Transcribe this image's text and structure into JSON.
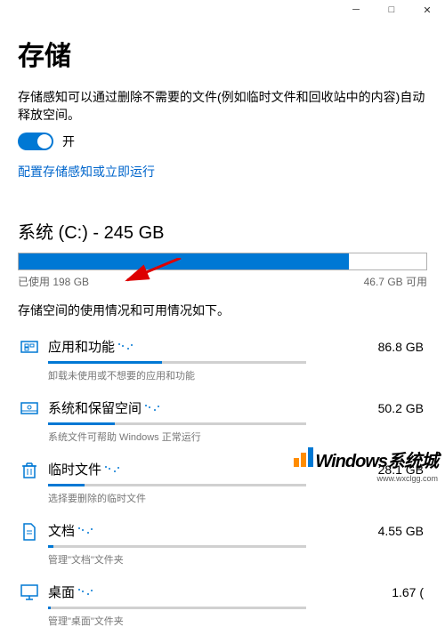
{
  "page_title": "存储",
  "description": "存储感知可以通过删除不需要的文件(例如临时文件和回收站中的内容)自动释放空间。",
  "toggle_state": "开",
  "config_link": "配置存储感知或立即运行",
  "drive": {
    "label": "系统 (C:) - 245 GB",
    "used_label": "已使用 198 GB",
    "free_label": "46.7 GB 可用",
    "used_percent": 81
  },
  "caption": "存储空间的使用情况和可用情况如下。",
  "categories": [
    {
      "title": "应用和功能",
      "size": "86.8 GB",
      "sub": "卸载未使用或不想要的应用和功能",
      "pct": 44,
      "icon": "apps"
    },
    {
      "title": "系统和保留空间",
      "size": "50.2 GB",
      "sub": "系统文件可帮助 Windows 正常运行",
      "pct": 26,
      "icon": "system"
    },
    {
      "title": "临时文件",
      "size": "28.1 GB",
      "sub": "选择要删除的临时文件",
      "pct": 14,
      "icon": "trash"
    },
    {
      "title": "文档",
      "size": "4.55 GB",
      "sub": "管理\"文档\"文件夹",
      "pct": 2,
      "icon": "doc"
    },
    {
      "title": "桌面",
      "size": "1.67 (",
      "sub": "管理\"桌面\"文件夹",
      "pct": 1,
      "icon": "desktop"
    }
  ],
  "watermark": {
    "text": "Windows系统城",
    "url": "www.wxclgg.com"
  }
}
